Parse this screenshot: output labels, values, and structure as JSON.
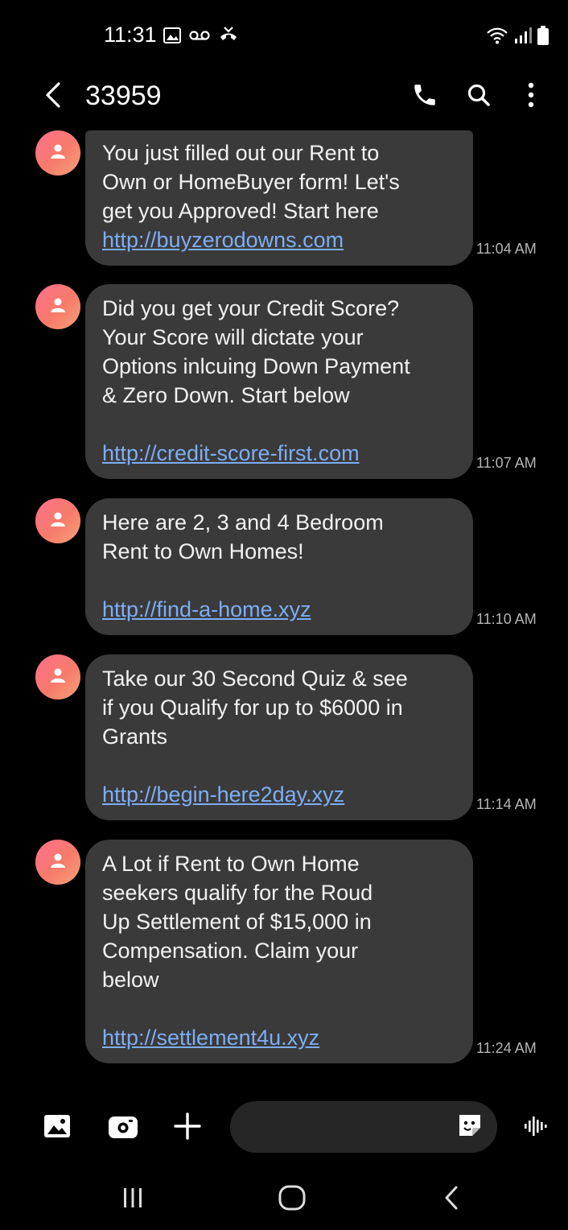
{
  "status_bar": {
    "time": "11:31",
    "left_icons": [
      "gallery-icon",
      "voicemail-icon",
      "missed-call-icon"
    ],
    "right_icons": [
      "wifi-icon",
      "signal-icon",
      "battery-icon"
    ]
  },
  "header": {
    "contact": "33959",
    "icons": [
      "back-arrow-icon",
      "phone-icon",
      "search-icon",
      "more-vertical-icon"
    ]
  },
  "messages": [
    {
      "text": "You just filled out our Rent to\nOwn or HomeBuyer form! Let's\nget you Approved! Start here",
      "link": "http://buyzerodowns.com",
      "time": "11:04 AM"
    },
    {
      "text": "Did you get your Credit Score?\nYour Score will dictate your\nOptions inlcuing Down Payment\n& Zero Down. Start below",
      "link": "http://credit-score-first.com",
      "time": "11:07 AM"
    },
    {
      "text": "Here are 2, 3 and 4 Bedroom\nRent to Own Homes!",
      "link": "http://find-a-home.xyz",
      "time": "11:10 AM"
    },
    {
      "text": "Take our 30 Second Quiz & see\nif you Qualify for up to $6000 in\nGrants",
      "link": "http://begin-here2day.xyz",
      "time": "11:14 AM"
    },
    {
      "text": "A Lot if Rent to Own Home\nseekers qualify for the Roud\nUp Settlement of $15,000 in\nCompensation. Claim your\nbelow",
      "link": "http://settlement4u.xyz",
      "time": "11:24 AM"
    }
  ],
  "composer": {
    "input_value": "",
    "placeholder": "",
    "icons": [
      "image-icon",
      "camera-icon",
      "plus-icon",
      "sticker-icon",
      "voice-wave-icon"
    ]
  },
  "navbar": {
    "icons": [
      "recent-apps-icon",
      "home-icon",
      "back-icon"
    ]
  },
  "colors": {
    "background": "#000000",
    "bubble": "#3a3a3a",
    "link": "#7eadf3",
    "avatar_start": "#ff6f8e",
    "avatar_end": "#f6a27a"
  }
}
